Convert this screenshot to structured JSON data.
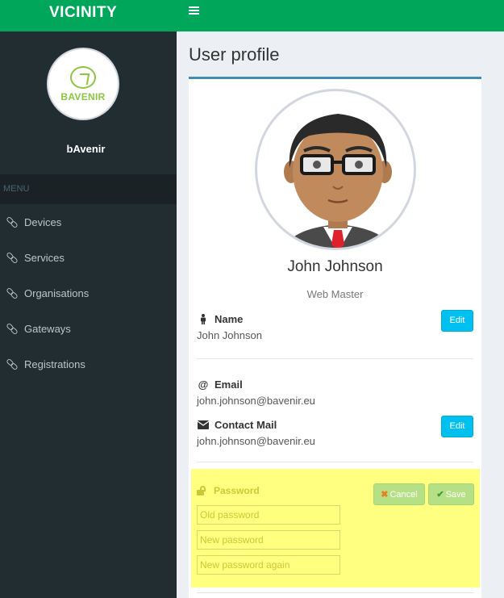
{
  "app": {
    "title": "VICINITY"
  },
  "sidebar": {
    "org_logo_text": "BAVENIR",
    "org_name": "bAvenir",
    "menu_header": "MENU",
    "items": [
      {
        "label": "Devices",
        "icon": "link-icon"
      },
      {
        "label": "Services",
        "icon": "link-icon"
      },
      {
        "label": "Organisations",
        "icon": "link-icon"
      },
      {
        "label": "Gateways",
        "icon": "link-icon"
      },
      {
        "label": "Registrations",
        "icon": "link-icon"
      }
    ]
  },
  "topbar": {
    "menu_icon": "hamburger-icon"
  },
  "page": {
    "title": "User profile"
  },
  "profile": {
    "name": "John Johnson",
    "role": "Web Master",
    "fields": {
      "name": {
        "label": "Name",
        "value": "John Johnson",
        "edit_label": "Edit",
        "icon": "person-icon"
      },
      "email": {
        "label": "Email",
        "value": "john.johnson@bavenir.eu",
        "icon": "at-icon"
      },
      "contact_mail": {
        "label": "Contact Mail",
        "value": "john.johnson@bavenir.eu",
        "edit_label": "Edit",
        "icon": "envelope-icon"
      }
    },
    "password": {
      "label": "Password",
      "icon": "unlock-icon",
      "cancel_label": "Cancel",
      "save_label": "Save",
      "old_placeholder": "Old password",
      "new_placeholder": "New password",
      "again_placeholder": "New password again"
    }
  },
  "colors": {
    "brand_green": "#00a65a",
    "sidebar_bg": "#222d32",
    "accent_blue": "#3c8dbc",
    "edit_button": "#00c0ef",
    "password_highlight": "#ffff80"
  }
}
